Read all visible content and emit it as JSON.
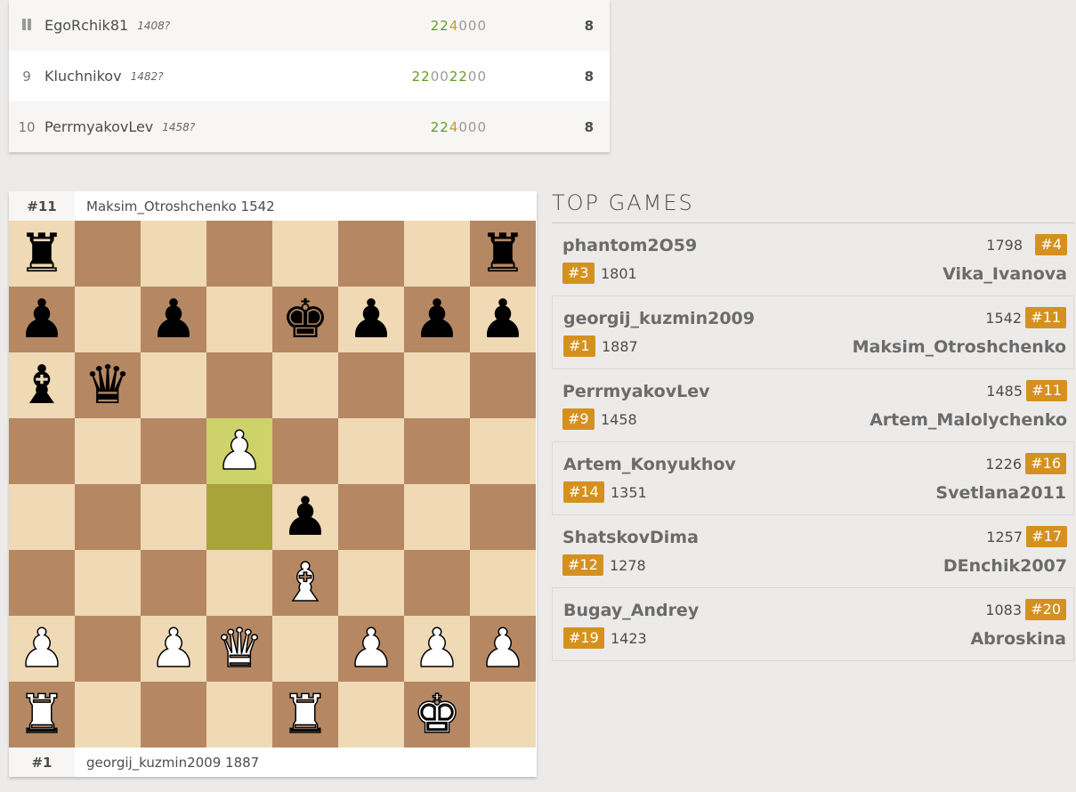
{
  "standings": [
    {
      "rank": "",
      "paused": true,
      "name": "EgoRchik81",
      "rating": "1408?",
      "sheet": [
        [
          "2",
          "win"
        ],
        [
          "2",
          "win"
        ],
        [
          "4",
          "draw"
        ],
        [
          "0",
          "loss"
        ],
        [
          "0",
          "loss"
        ],
        [
          "0",
          "loss"
        ]
      ],
      "total": "8"
    },
    {
      "rank": "9",
      "paused": false,
      "name": "Kluchnikov",
      "rating": "1482?",
      "sheet": [
        [
          "2",
          "win"
        ],
        [
          "2",
          "win"
        ],
        [
          "0",
          "loss"
        ],
        [
          "0",
          "loss"
        ],
        [
          "2",
          "win"
        ],
        [
          "2",
          "win"
        ],
        [
          "0",
          "loss"
        ],
        [
          "0",
          "loss"
        ]
      ],
      "total": "8"
    },
    {
      "rank": "10",
      "paused": false,
      "name": "PerrmyakovLev",
      "rating": "1458?",
      "sheet": [
        [
          "2",
          "win"
        ],
        [
          "2",
          "win"
        ],
        [
          "4",
          "draw"
        ],
        [
          "0",
          "loss"
        ],
        [
          "0",
          "loss"
        ],
        [
          "0",
          "loss"
        ]
      ],
      "total": "8"
    }
  ],
  "board_panel": {
    "top_player": {
      "rank": "#11",
      "info": "Maksim_Otroshchenko 1542"
    },
    "bottom_player": {
      "rank": "#1",
      "info": "georgij_kuzmin2009 1887"
    },
    "fen_rows": [
      "r......r",
      "p.p.kppp",
      "bq......",
      "...P....",
      "....p...",
      "....B...",
      "P.PQ.PPP",
      "R...R.K."
    ],
    "highlight": [
      [
        3,
        3
      ],
      [
        4,
        3
      ]
    ]
  },
  "top_games": {
    "title": "TOP GAMES",
    "games": [
      {
        "white": "phantom2O59",
        "white_rank": "#3",
        "white_rating": "1801",
        "black": "Vika_Ivanova",
        "black_rank": "#4",
        "black_rating": "1798",
        "boxed": false
      },
      {
        "white": "georgij_kuzmin2009",
        "white_rank": "#1",
        "white_rating": "1887",
        "black": "Maksim_Otroshchenko",
        "black_rank": "#11",
        "black_rating": "1542",
        "boxed": true
      },
      {
        "white": "PerrmyakovLev",
        "white_rank": "#9",
        "white_rating": "1458",
        "black": "Artem_Malolychenko",
        "black_rank": "#11",
        "black_rating": "1485",
        "boxed": false
      },
      {
        "white": "Artem_Konyukhov",
        "white_rank": "#14",
        "white_rating": "1351",
        "black": "Svetlana2011",
        "black_rank": "#16",
        "black_rating": "1226",
        "boxed": true
      },
      {
        "white": "ShatskovDima",
        "white_rank": "#12",
        "white_rating": "1278",
        "black": "DEnchik2007",
        "black_rank": "#17",
        "black_rating": "1257",
        "boxed": false
      },
      {
        "white": "Bugay_Andrey",
        "white_rank": "#19",
        "white_rating": "1423",
        "black": "Abroskina",
        "black_rank": "#20",
        "black_rating": "1083",
        "boxed": true
      }
    ]
  }
}
